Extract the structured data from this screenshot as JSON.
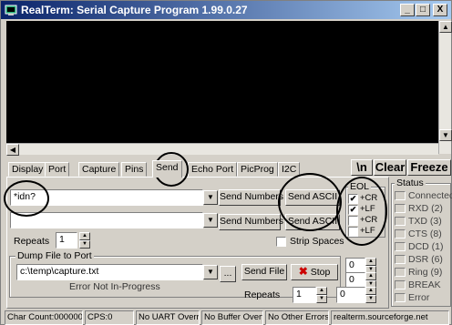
{
  "window": {
    "title": "RealTerm: Serial Capture Program 1.99.0.27",
    "minimize": "_",
    "maximize": "□",
    "close": "X"
  },
  "tabs": [
    {
      "label": "Display",
      "active": false
    },
    {
      "label": "Port",
      "active": false
    },
    {
      "label": "Capture",
      "active": false
    },
    {
      "label": "Pins",
      "active": false
    },
    {
      "label": "Send",
      "active": true
    },
    {
      "label": "Echo Port",
      "active": false
    },
    {
      "label": "PicProg",
      "active": false
    },
    {
      "label": "I2C",
      "active": false
    }
  ],
  "toolbar": {
    "newline": "\\n",
    "clear": "Clear",
    "freeze": "Freeze"
  },
  "send": {
    "input1": "*idn?",
    "input2": "",
    "send_numbers_1": "Send Numbers",
    "send_ascii_1": "Send ASCII",
    "send_numbers_2": "Send Numbers",
    "send_ascii_2": "Send ASCII",
    "repeats_label": "Repeats",
    "repeats_value": "1",
    "strip_spaces": "Strip Spaces"
  },
  "eol": {
    "title": "EOL",
    "row1": [
      {
        "label": "+CR",
        "checked": true
      },
      {
        "label": "+LF",
        "checked": true
      }
    ],
    "row2": [
      {
        "label": "+CR",
        "checked": false
      },
      {
        "label": "+LF",
        "checked": false
      }
    ]
  },
  "dump": {
    "title": "Dump File to Port",
    "file": "c:\\temp\\capture.txt",
    "browse": "...",
    "send_file": "Send File",
    "stop": "Stop",
    "stop_icon": "x-icon",
    "progress_text": "Error Not In-Progress",
    "progress": 0,
    "repeats_label": "Repeats",
    "repeats_value": "1",
    "spin1": "0",
    "spin2": "0",
    "spin3": "0"
  },
  "status": {
    "title": "Status",
    "items": [
      "Connected",
      "RXD (2)",
      "TXD (3)",
      "CTS (8)",
      "DCD (1)",
      "DSR (6)",
      "Ring (9)",
      "BREAK",
      "Error"
    ]
  },
  "statusbar": {
    "char_count": "Char Count:0000000",
    "cps": "CPS:0",
    "uart": "No UART Overr",
    "buffer": "No Buffer Overfl",
    "errors": "No Other Errors",
    "site": "realterm.sourceforge.net"
  },
  "colors": {
    "titlebar_start": "#0a246a",
    "titlebar_end": "#a6caf0",
    "terminal_bg": "#000000",
    "stop_icon": "#cc0000"
  }
}
